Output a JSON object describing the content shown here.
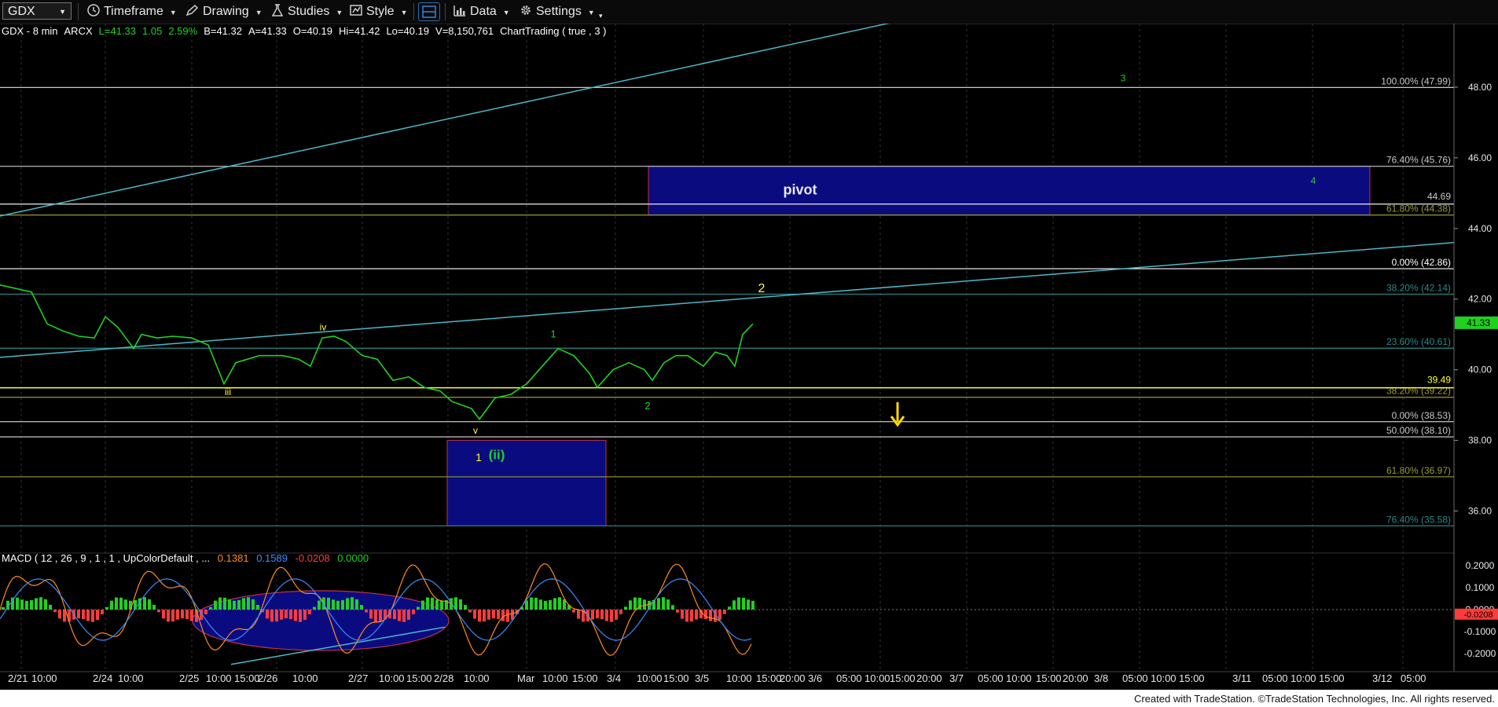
{
  "toolbar": {
    "symbol": "GDX",
    "timeframe": "Timeframe",
    "drawing": "Drawing",
    "studies": "Studies",
    "style": "Style",
    "data": "Data",
    "settings": "Settings"
  },
  "info": {
    "symbol_interval": "GDX - 8 min",
    "exchange": "ARCX",
    "last": "L=41.33",
    "change": "1.05",
    "change_pct": "2.59%",
    "bid": "B=41.32",
    "ask": "A=41.33",
    "open": "O=40.19",
    "high": "Hi=41.42",
    "low": "Lo=40.19",
    "volume": "V=8,150,761",
    "study": "ChartTrading ( true , 3 )"
  },
  "price_axis": {
    "ticks": [
      "48.00",
      "46.00",
      "44.00",
      "42.00",
      "40.00",
      "38.00",
      "36.00"
    ],
    "ylim": [
      34.9,
      49.8
    ],
    "last_price_flag": "41.33",
    "last_price_color": "#1fd21f"
  },
  "macd": {
    "label": "MACD ( 12 , 26 , 9 , 1 , 1 , UpColorDefault , ...",
    "values": [
      "0.1381",
      "0.1589",
      "-0.0208",
      "0.0000"
    ],
    "value_colors": [
      "#ff8c1a",
      "#3a8bff",
      "#ff3b3b",
      "#1fd21f"
    ],
    "ticks": [
      "0.2000",
      "0.1000",
      "0.0000",
      "-0.1000",
      "-0.2000"
    ],
    "flag": "-0.0208"
  },
  "time_axis": {
    "labels": [
      "2/21",
      "10:00",
      "2/24",
      "10:00",
      "2/25",
      "10:00",
      "15:00",
      "2/26",
      "10:00",
      "2/27",
      "10:00",
      "15:00",
      "2/28",
      "10:00",
      "Mar",
      "10:00",
      "15:00",
      "3/4",
      "10:00",
      "15:00",
      "3/5",
      "10:00",
      "15:00",
      "20:00",
      "3/6",
      "05:00",
      "10:00",
      "15:00",
      "20:00",
      "3/7",
      "05:00",
      "10:00",
      "15:00",
      "20:00",
      "3/8",
      "05:00",
      "10:00",
      "15:00",
      "3/11",
      "05:00",
      "10:00",
      "15:00",
      "3/12",
      "05:00"
    ]
  },
  "fibs": [
    {
      "label": "100.00% (47.99)",
      "price": 47.99,
      "color": "#c8c8c8"
    },
    {
      "label": "76.40% (45.76)",
      "price": 45.76,
      "color": "#c8c8c8"
    },
    {
      "label": "61.80% (44.38)",
      "price": 44.38,
      "color": "#9a9a3a"
    },
    {
      "label": "0.00% (42.86)",
      "price": 42.86,
      "color": "#ffffff"
    },
    {
      "label": "38.20% (42.14)",
      "price": 42.14,
      "color": "#2a8a8a"
    },
    {
      "label": "23.60% (40.61)",
      "price": 40.61,
      "color": "#2a8a8a"
    },
    {
      "label": "38.20% (39.22)",
      "price": 39.22,
      "color": "#9a9a3a"
    },
    {
      "label": "0.00% (38.53)",
      "price": 38.53,
      "color": "#c8c8c8"
    },
    {
      "label": "50.00% (38.10)",
      "price": 38.1,
      "color": "#c8c8c8"
    },
    {
      "label": "61.80% (36.97)",
      "price": 36.97,
      "color": "#9a9a3a"
    },
    {
      "label": "76.40% (35.58)",
      "price": 35.58,
      "color": "#2a8a8a"
    }
  ],
  "hlines": [
    {
      "label": "44.69",
      "price": 44.69,
      "color": "#c8c8c8"
    },
    {
      "label": "39.49",
      "price": 39.49,
      "color": "#ffff33"
    }
  ],
  "annotations": {
    "pivot": "pivot",
    "wave_ii": "(ii)",
    "wave_1_box": "1",
    "wave_iii": "iii",
    "wave_iv": "iv",
    "wave_v": "v",
    "wave_1": "1",
    "wave_2_small": "2",
    "wave_2_yellow": "2",
    "wave_3": "3",
    "wave_4": "4"
  },
  "footer": "Created with TradeStation. ©TradeStation Technologies, Inc. All rights reserved."
}
